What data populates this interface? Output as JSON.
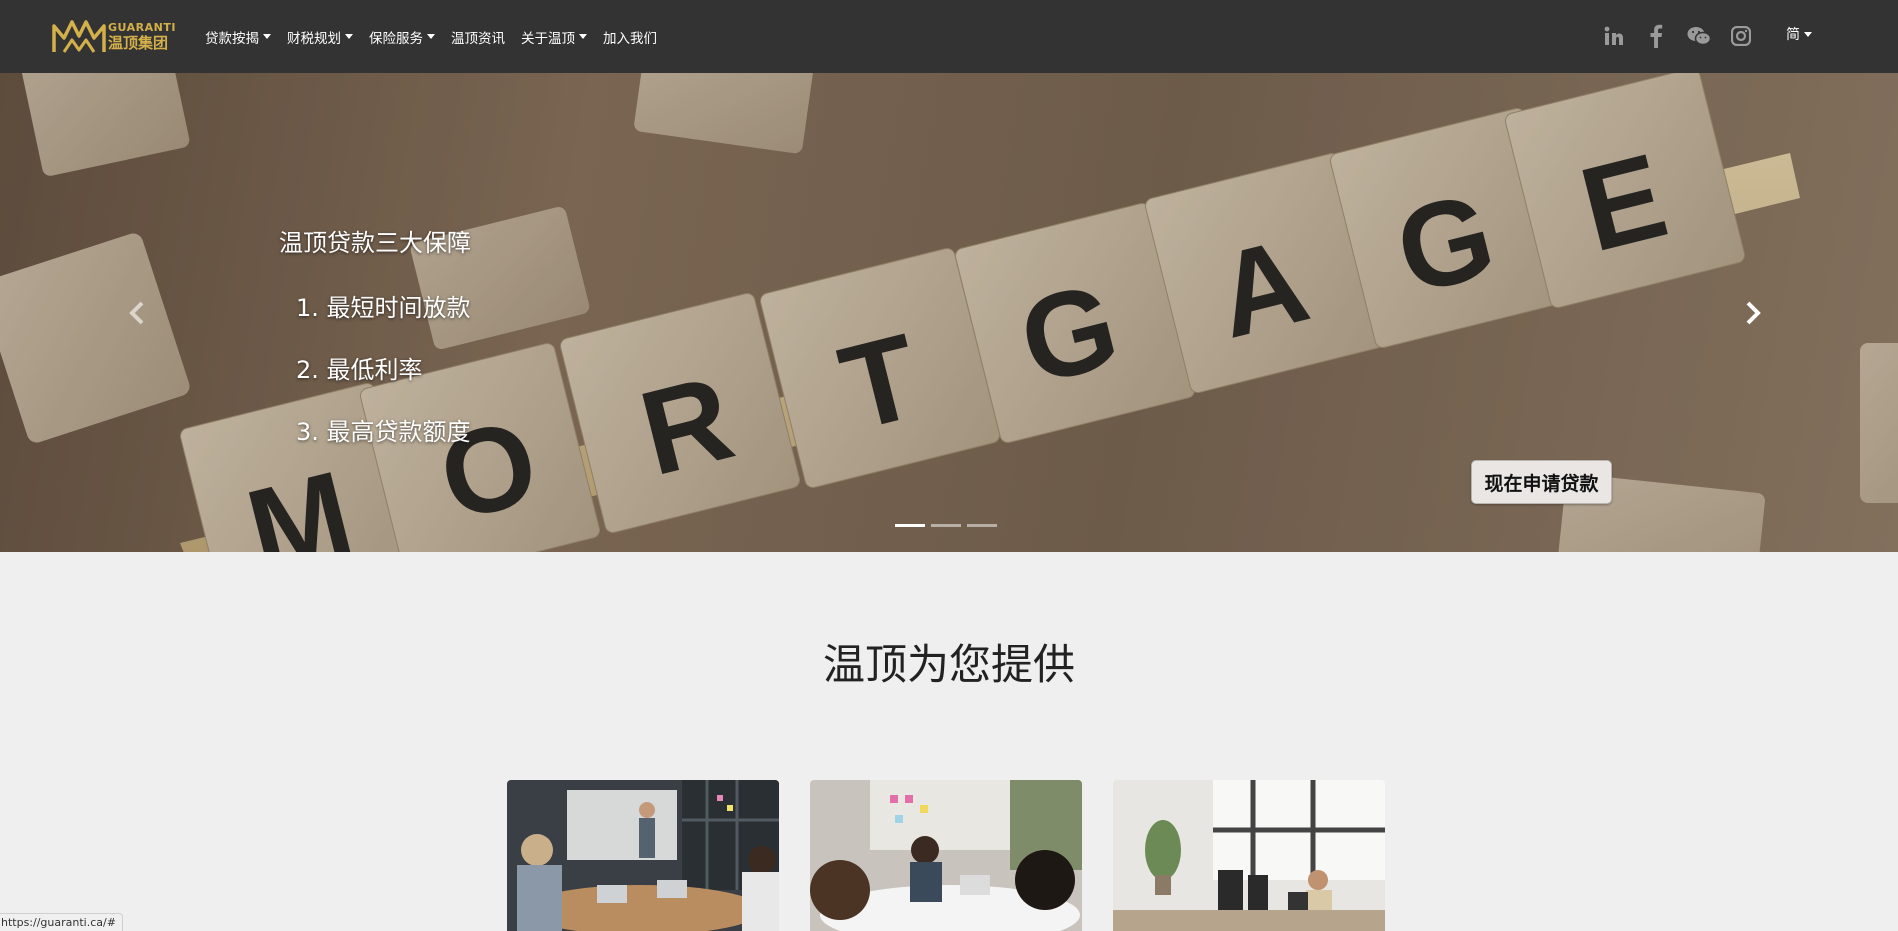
{
  "navbar": {
    "logo_en": "GUARANTI",
    "logo_cn": "温顶集团",
    "items": [
      {
        "label": "贷款按揭",
        "dropdown": true
      },
      {
        "label": "财税规划",
        "dropdown": true
      },
      {
        "label": "保险服务",
        "dropdown": true
      },
      {
        "label": "温顶资讯",
        "dropdown": false
      },
      {
        "label": "关于温顶",
        "dropdown": true
      },
      {
        "label": "加入我们",
        "dropdown": false
      }
    ],
    "social_icons": [
      "linkedin-icon",
      "facebook-icon",
      "wechat-icon",
      "instagram-icon"
    ],
    "language": "简"
  },
  "hero": {
    "background_word": "MORTGAGE",
    "title": "温顶贷款三大保障",
    "points": [
      "1. 最短时间放款",
      "2. 最低利率",
      "3. 最高贷款额度"
    ],
    "cta_label": "现在申请贷款",
    "slide_count": 3,
    "active_slide": 0
  },
  "section": {
    "title": "温顶为您提供"
  },
  "status_bar": {
    "url": "https://guaranti.ca/#"
  },
  "colors": {
    "navbar_bg": "#333333",
    "logo_gold": "#d4b04a",
    "page_bg": "#efefef"
  }
}
